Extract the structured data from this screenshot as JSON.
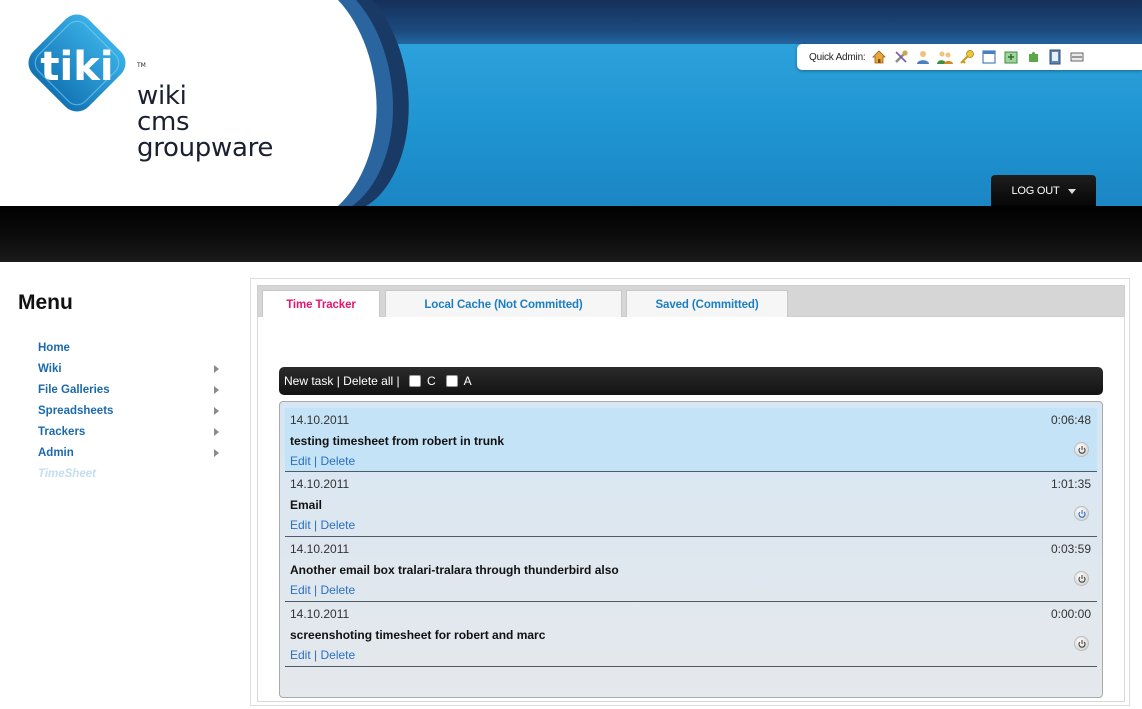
{
  "logo": {
    "mark": "tiki",
    "tm": "TM",
    "lines": [
      "wiki",
      "cms",
      "groupware"
    ]
  },
  "quick_admin": {
    "label": "Quick Admin:",
    "icons": [
      "home-icon",
      "tools-icon",
      "users-icon",
      "group-icon",
      "permissions-key-icon",
      "modules-window-icon",
      "wizard-icon",
      "plugins-icon",
      "file-icon",
      "panel-icon"
    ]
  },
  "header": {
    "logout_label": "LOG OUT"
  },
  "sidebar": {
    "title": "Menu",
    "items": [
      {
        "label": "Home",
        "has_submenu": false
      },
      {
        "label": "Wiki",
        "has_submenu": true
      },
      {
        "label": "File Galleries",
        "has_submenu": true
      },
      {
        "label": "Spreadsheets",
        "has_submenu": true
      },
      {
        "label": "Trackers",
        "has_submenu": true
      },
      {
        "label": "Admin",
        "has_submenu": true
      },
      {
        "label": "TimeSheet",
        "has_submenu": false
      }
    ]
  },
  "tabs": [
    {
      "label": "Time Tracker",
      "active": true
    },
    {
      "label": "Local Cache (Not Committed)",
      "active": false
    },
    {
      "label": "Saved (Committed)",
      "active": false
    }
  ],
  "toolbar": {
    "new_task": "New task",
    "sep": " | ",
    "delete_all": "Delete all",
    "sep2": " | ",
    "check_c": "C",
    "check_a": "A"
  },
  "tasks": [
    {
      "date": "14.10.2011",
      "time": "0:06:48",
      "title": "testing timesheet from robert in trunk",
      "edit": "Edit",
      "sep": " | ",
      "delete": "Delete",
      "highlight": true
    },
    {
      "date": "14.10.2011",
      "time": "1:01:35",
      "title": "Email",
      "edit": "Edit",
      "sep": " | ",
      "delete": "Delete",
      "highlight": false
    },
    {
      "date": "14.10.2011",
      "time": "0:03:59",
      "title": "Another email box tralari-tralara through thunderbird also",
      "edit": "Edit",
      "sep": " | ",
      "delete": "Delete",
      "highlight": false
    },
    {
      "date": "14.10.2011",
      "time": "0:00:00",
      "title": "screenshoting timesheet for robert and marc",
      "edit": "Edit",
      "sep": " | ",
      "delete": "Delete",
      "highlight": false
    }
  ],
  "colors": {
    "banner_blue": "#1f95d2",
    "banner_navy": "#15305a",
    "link_blue": "#1c6aad",
    "tab_active": "#e6156f",
    "tab_link": "#1c7ec2"
  }
}
